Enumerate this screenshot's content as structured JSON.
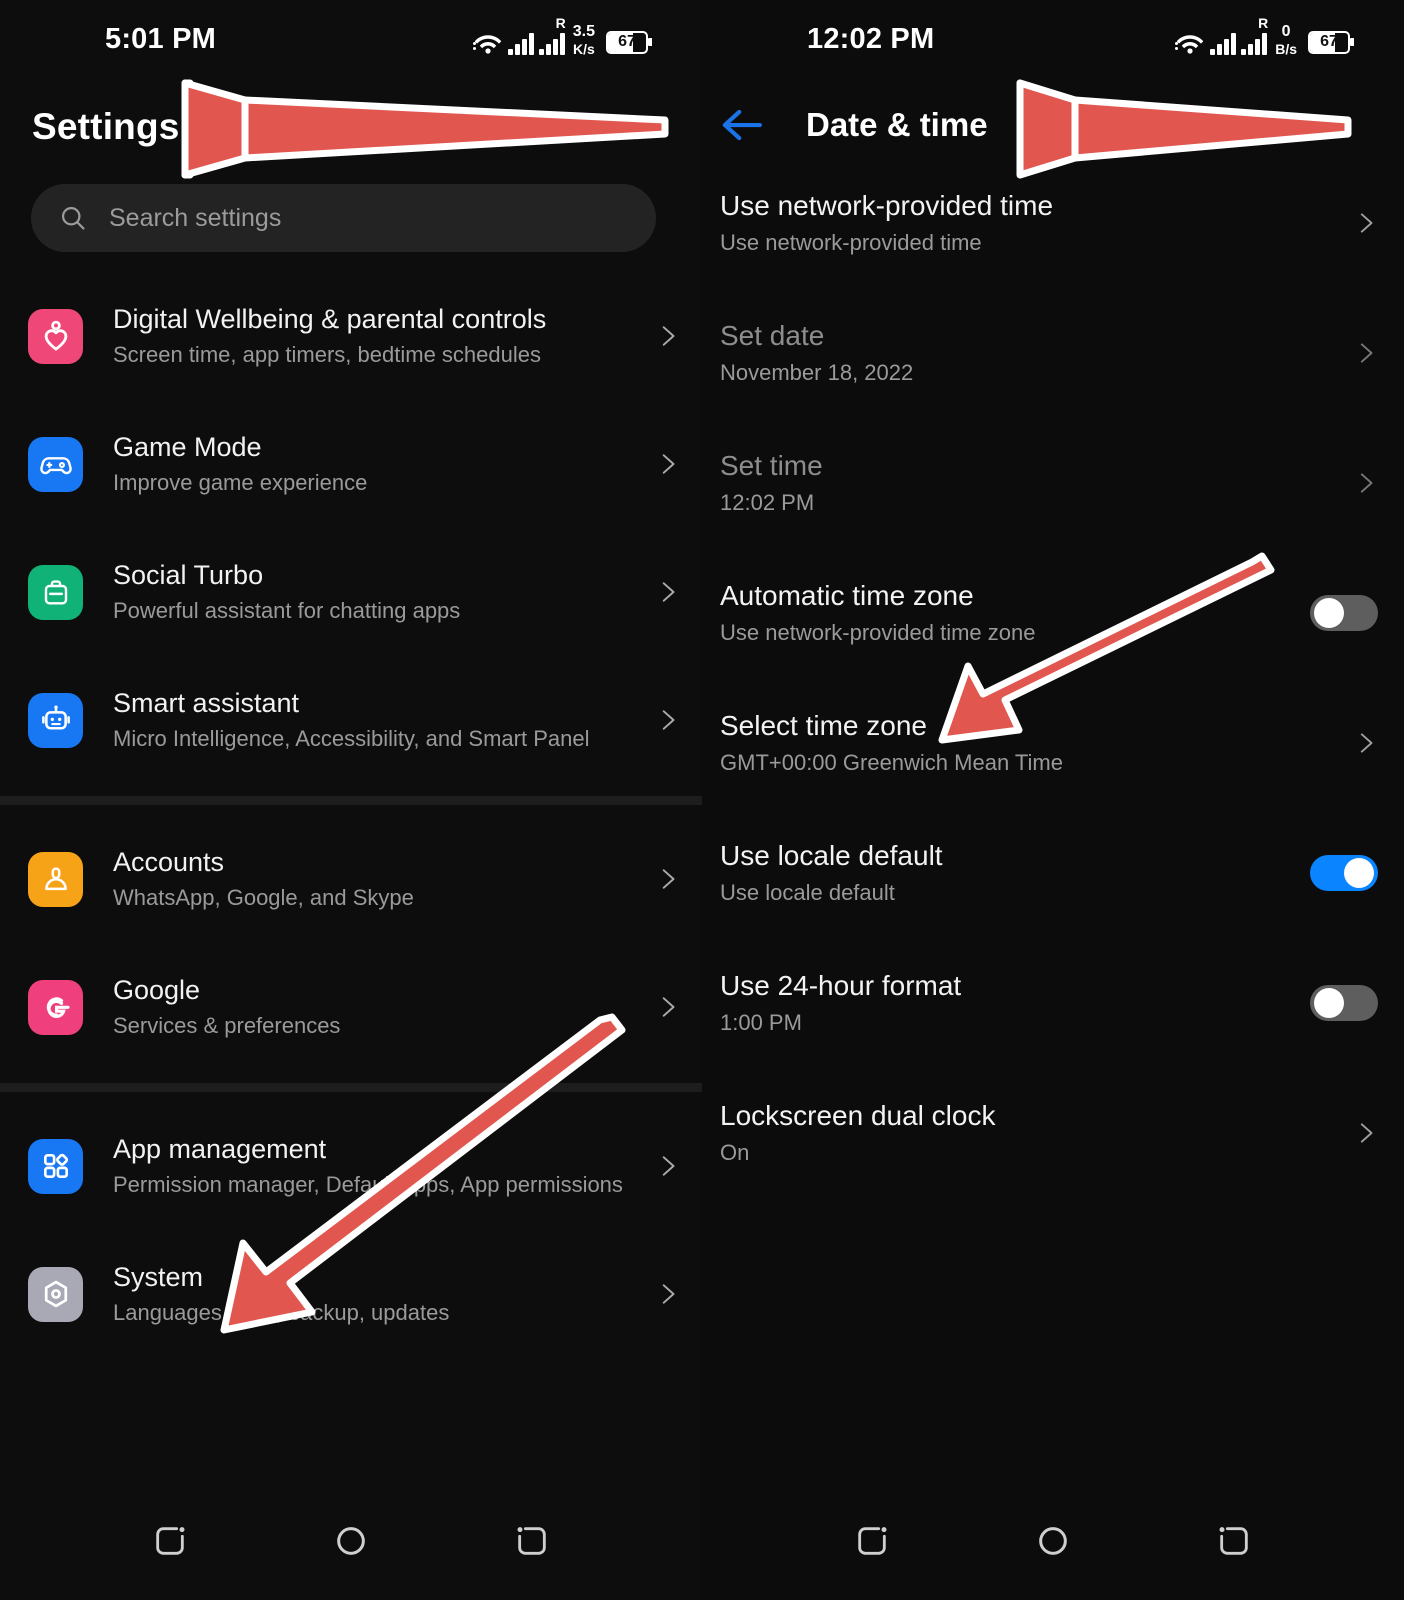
{
  "left_panel": {
    "status_bar": {
      "time": "5:01 PM",
      "net_speed_value": "3.5",
      "net_speed_unit": "K/s",
      "roaming_indicator": "R",
      "battery_level": "67"
    },
    "page_title": "Settings",
    "search": {
      "placeholder": "Search settings"
    },
    "groups": [
      {
        "items": [
          {
            "icon": "heart-wellbeing-icon",
            "icon_color": "#ef4777",
            "title": "Digital Wellbeing & parental controls",
            "subtitle": "Screen time, app timers, bedtime schedules"
          },
          {
            "icon": "gamepad-icon",
            "icon_color": "#1877f2",
            "title": "Game Mode",
            "subtitle": "Improve game experience"
          },
          {
            "icon": "briefcase-icon",
            "icon_color": "#11b277",
            "title": "Social Turbo",
            "subtitle": "Powerful assistant for chatting apps"
          },
          {
            "icon": "robot-icon",
            "icon_color": "#1877f2",
            "title": "Smart assistant",
            "subtitle": "Micro Intelligence, Accessibility, and Smart Panel"
          }
        ]
      },
      {
        "items": [
          {
            "icon": "person-account-icon",
            "icon_color": "#f6a317",
            "title": "Accounts",
            "subtitle": "WhatsApp, Google, and Skype"
          },
          {
            "icon": "google-g-icon",
            "icon_color": "#ef3f7d",
            "title": "Google",
            "subtitle": "Services & preferences"
          }
        ]
      },
      {
        "items": [
          {
            "icon": "apps-grid-icon",
            "icon_color": "#1877f2",
            "title": "App management",
            "subtitle": "Permission manager, Default apps, App permissions"
          },
          {
            "icon": "system-gear-hex-icon",
            "icon_color": "#a9a9b5",
            "title": "System",
            "subtitle": "Languages, time, backup, updates"
          }
        ]
      }
    ],
    "nav_bar": {
      "recents_label": "recents-icon",
      "home_label": "home-icon",
      "back_label": "back-icon"
    }
  },
  "right_panel": {
    "status_bar": {
      "time": "12:02 PM",
      "net_speed_value": "0",
      "net_speed_unit": "B/s",
      "roaming_indicator": "R",
      "battery_level": "67"
    },
    "header": {
      "title": "Date & time",
      "back_icon": "back-arrow-icon"
    },
    "items": [
      {
        "title": "Use network-provided time",
        "subtitle": "Use network-provided time",
        "control": "chevron",
        "dim": false
      },
      {
        "title": "Set date",
        "subtitle": "November 18, 2022",
        "control": "chevron",
        "dim": true
      },
      {
        "title": "Set time",
        "subtitle": "12:02 PM",
        "control": "chevron",
        "dim": true
      },
      {
        "title": "Automatic time zone",
        "subtitle": "Use network-provided time zone",
        "control": "toggle-off",
        "dim": false
      },
      {
        "title": "Select time zone",
        "subtitle": "GMT+00:00 Greenwich Mean Time",
        "control": "chevron",
        "dim": false
      },
      {
        "title": "Use locale default",
        "subtitle": "Use locale default",
        "control": "toggle-on",
        "dim": false
      },
      {
        "title": "Use 24-hour format",
        "subtitle": "1:00 PM",
        "control": "toggle-off",
        "dim": false
      },
      {
        "title": "Lockscreen dual clock",
        "subtitle": "On",
        "control": "chevron",
        "dim": false
      }
    ],
    "nav_bar": {
      "recents_label": "recents-icon",
      "home_label": "home-icon",
      "back_label": "back-icon"
    }
  },
  "annotations": {
    "arrow_color": "#e1564f",
    "arrow_outline_color": "#ffffff",
    "arrows": [
      {
        "name": "arrow-to-settings-title",
        "points_at": "Settings"
      },
      {
        "name": "arrow-to-date-time-title",
        "points_at": "Date & time"
      },
      {
        "name": "arrow-to-system",
        "points_at": "System"
      },
      {
        "name": "arrow-to-select-time-zone",
        "points_at": "Select time zone"
      }
    ]
  }
}
